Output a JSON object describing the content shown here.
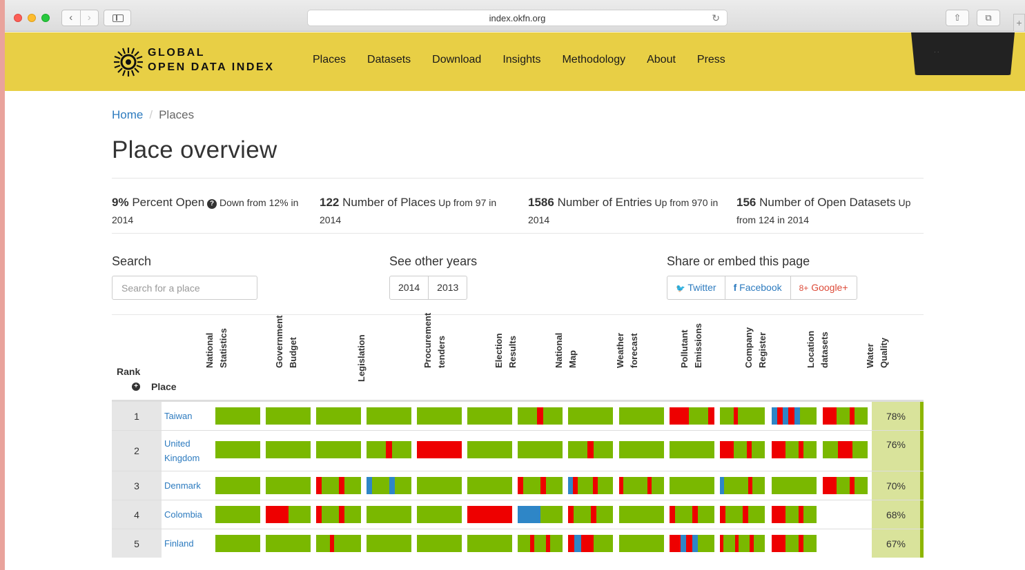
{
  "browser": {
    "url": "index.okfn.org",
    "reload_icon": "↻",
    "share_icon": "⇧",
    "tabs_icon": "⧉",
    "new_tab_icon": "+",
    "back_icon": "‹",
    "forward_icon": "›"
  },
  "header": {
    "logo_line1": "GLOBAL",
    "logo_line2": "OPEN DATA INDEX",
    "nav": [
      "Places",
      "Datasets",
      "Download",
      "Insights",
      "Methodology",
      "About",
      "Press"
    ],
    "dark_box_text": "· ·"
  },
  "breadcrumb": {
    "home": "Home",
    "separator": "/",
    "current": "Places"
  },
  "page_title": "Place overview",
  "stats": [
    {
      "value": "9%",
      "label": "Percent Open",
      "change": "Down from 12% in 2014",
      "has_help": true
    },
    {
      "value": "122",
      "label": "Number of Places",
      "change": "Up from 97 in 2014",
      "has_help": false
    },
    {
      "value": "1586",
      "label": "Number of Entries",
      "change": "Up from 970 in 2014",
      "has_help": false
    },
    {
      "value": "156",
      "label": "Number of Open Datasets",
      "change": "Up from 124 in 2014",
      "has_help": false
    }
  ],
  "help_icon": "?",
  "search": {
    "label": "Search",
    "placeholder": "Search for a place"
  },
  "years": {
    "label": "See other years",
    "options": [
      "2014",
      "2013"
    ]
  },
  "share": {
    "label": "Share or embed this page",
    "twitter": "Twitter",
    "facebook": "Facebook",
    "google": "Google+",
    "twitter_icon": "🐦",
    "facebook_icon": "f",
    "google_icon": "8+"
  },
  "table": {
    "rank_header": "Rank",
    "place_header": "Place",
    "sort_icon": "+",
    "columns": [
      "National\nStatistics",
      "Government\nBudget",
      "Legislation",
      "Procurement\ntenders",
      "Election\nResults",
      "National\nMap",
      "Weather\nforecast",
      "Pollutant\nEmissions",
      "Company\nRegister",
      "Location\ndatasets",
      "Water\nQuality"
    ],
    "colors": {
      "green": "#7ab800",
      "red": "#ee0000",
      "blue": "#2e86c7"
    },
    "rows": [
      {
        "rank": "1",
        "place": "Taiwan",
        "score": "78%",
        "cells": [
          "G",
          "G",
          "G",
          "G",
          "G",
          "G",
          "GRG",
          "G",
          "G",
          "RRRGR",
          "GRGG",
          "BRBRBG",
          "RRRGRG"
        ]
      },
      {
        "rank": "2",
        "place": "United Kingdom",
        "score": "76%",
        "cells": [
          "G",
          "G",
          "G",
          "GRG",
          "R",
          "G",
          "G",
          "GRG",
          "G",
          "G",
          "RRRGRG",
          "RRRGRG",
          "GRRRG"
        ]
      },
      {
        "rank": "3",
        "place": "Denmark",
        "score": "70%",
        "cells": [
          "G",
          "G",
          "RGRG",
          "BGBG",
          "G",
          "G",
          "RGRG",
          "BRGRG",
          "RGGRG",
          "G",
          "BGGRG",
          "G",
          "RRRGRG"
        ]
      },
      {
        "rank": "4",
        "place": "Colombia",
        "score": "68%",
        "cells": [
          "G",
          "RG",
          "RGRG",
          "G",
          "G",
          "R",
          "BG",
          "RGRG",
          "G",
          "RGRG",
          "RGRG",
          "RRRGRG"
        ]
      },
      {
        "rank": "5",
        "place": "Finland",
        "score": "67%",
        "cells": [
          "G",
          "G",
          "GRGG",
          "G",
          "G",
          "G",
          "GRGRG",
          "RBRRG",
          "G",
          "RRBRBG",
          "RGRGRG",
          "RRRGRG"
        ]
      }
    ]
  }
}
